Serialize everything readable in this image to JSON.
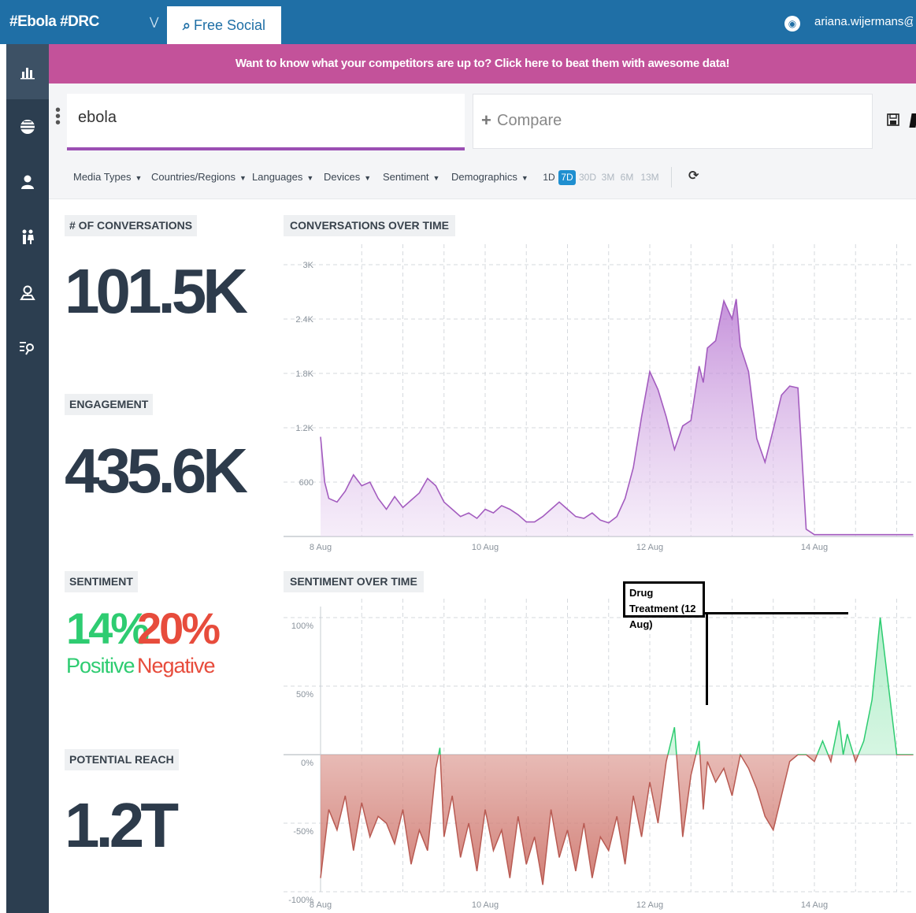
{
  "topbar": {
    "project": "#Ebola #DRC",
    "tab_label": "Free Social Search",
    "user": "ariana.wijermans@g..."
  },
  "sidebar": {
    "items": [
      {
        "icon": "bar-chart-icon",
        "active": true
      },
      {
        "icon": "globe-icon"
      },
      {
        "icon": "person-icon"
      },
      {
        "icon": "people-icon"
      },
      {
        "icon": "location-icon"
      },
      {
        "icon": "search-list-icon"
      }
    ]
  },
  "banner": {
    "text": "Want to know what your competitors are up to? Click here to beat them with awesome data!"
  },
  "search": {
    "query": "ebola",
    "compare_label": "Compare"
  },
  "filters": {
    "items": [
      "Media Types",
      "Countries/Regions",
      "Languages",
      "Devices",
      "Sentiment",
      "Demographics"
    ],
    "ranges": [
      "1D",
      "7D",
      "30D",
      "3M",
      "6M",
      "13M"
    ],
    "active_range": "7D"
  },
  "metrics": {
    "conversations_label": "# OF CONVERSATIONS",
    "conversations_value": "101.5K",
    "engagement_label": "ENGAGEMENT",
    "engagement_value": "435.6K",
    "sentiment_label": "SENTIMENT",
    "positive_pct": "14%",
    "positive_label": "Positive",
    "negative_pct": "20%",
    "negative_label": "Negative",
    "reach_label": "POTENTIAL REACH",
    "reach_value": "1.2T"
  },
  "colors": {
    "topbar": "#1f6fa6",
    "sidebar": "#2c3e50",
    "banner": "#c3529a",
    "conversations_line": "#a35cbf",
    "positive": "#2ecc71",
    "negative": "#e74c3c",
    "negative_line": "#b85a52"
  },
  "chart_data": [
    {
      "type": "area",
      "title": "CONVERSATIONS OVER TIME",
      "x_ticks": [
        "8 Aug",
        "10 Aug",
        "12 Aug",
        "14 Aug"
      ],
      "y_ticks": [
        "600",
        "1.2K",
        "1.8K",
        "2.4K",
        "3K"
      ],
      "ylim": [
        0,
        3000
      ],
      "grid": true,
      "series": [
        {
          "x_days": [
            0,
            0.05,
            0.1,
            0.2,
            0.3,
            0.4,
            0.5,
            0.6,
            0.7,
            0.8,
            0.9,
            1.0,
            1.1,
            1.2,
            1.3,
            1.4,
            1.5,
            1.6,
            1.7,
            1.8,
            1.9,
            2.0,
            2.1,
            2.2,
            2.3,
            2.4,
            2.5,
            2.6,
            2.7,
            2.8,
            2.9,
            3.0,
            3.1,
            3.2,
            3.3,
            3.4,
            3.5,
            3.6,
            3.7,
            3.8,
            3.9,
            4.0,
            4.1,
            4.2,
            4.3,
            4.4,
            4.5,
            4.6,
            4.65,
            4.7,
            4.8,
            4.9,
            5.0,
            5.05,
            5.1,
            5.2,
            5.3,
            5.4,
            5.5,
            5.6,
            5.7,
            5.8,
            5.9,
            6.0,
            6.1,
            6.2,
            6.3,
            6.35,
            6.4,
            6.5,
            7.0,
            7.2
          ],
          "values": [
            1100,
            600,
            420,
            380,
            500,
            680,
            560,
            600,
            420,
            300,
            440,
            320,
            400,
            480,
            640,
            560,
            380,
            300,
            220,
            260,
            200,
            300,
            260,
            340,
            300,
            240,
            160,
            160,
            220,
            300,
            380,
            300,
            220,
            200,
            260,
            180,
            150,
            220,
            420,
            760,
            1320,
            1820,
            1620,
            1320,
            960,
            1220,
            1280,
            1880,
            1700,
            2080,
            2160,
            2600,
            2400,
            2620,
            2100,
            1820,
            1080,
            820,
            1180,
            1560,
            1660,
            1640,
            80,
            20,
            20,
            20,
            20,
            20,
            20,
            20,
            20,
            20
          ],
          "color": "#a35cbf"
        }
      ]
    },
    {
      "type": "area",
      "title": "SENTIMENT OVER TIME",
      "x_ticks": [
        "8 Aug",
        "10 Aug",
        "12 Aug",
        "14 Aug"
      ],
      "y_ticks": [
        "100%",
        "50%",
        "0%",
        "-50%",
        "-100%"
      ],
      "ylim": [
        -100,
        100
      ],
      "grid": true,
      "annotation": {
        "text": "Drug Treatment (12 Aug)"
      },
      "series": [
        {
          "x_days": [
            0,
            0.1,
            0.2,
            0.3,
            0.4,
            0.5,
            0.6,
            0.7,
            0.8,
            0.9,
            1.0,
            1.1,
            1.2,
            1.3,
            1.4,
            1.45,
            1.5,
            1.6,
            1.7,
            1.8,
            1.9,
            2.0,
            2.1,
            2.2,
            2.3,
            2.4,
            2.5,
            2.6,
            2.7,
            2.8,
            2.9,
            3.0,
            3.1,
            3.2,
            3.3,
            3.4,
            3.5,
            3.6,
            3.7,
            3.8,
            3.9,
            4.0,
            4.1,
            4.2,
            4.3,
            4.4,
            4.5,
            4.6,
            4.65,
            4.7,
            4.8,
            4.9,
            5.0,
            5.1,
            5.2,
            5.3,
            5.4,
            5.5,
            5.6,
            5.7,
            5.8,
            5.9,
            6.0,
            6.1,
            6.2,
            6.3,
            6.35,
            6.4,
            6.5,
            6.6,
            6.7,
            6.8,
            7.0,
            7.2
          ],
          "values": [
            -90,
            -40,
            -55,
            -30,
            -70,
            -35,
            -60,
            -45,
            -50,
            -65,
            -40,
            -80,
            -55,
            -70,
            -10,
            5,
            -60,
            -30,
            -75,
            -50,
            -85,
            -40,
            -70,
            -55,
            -90,
            -45,
            -80,
            -60,
            -95,
            -40,
            -75,
            -55,
            -85,
            -50,
            -90,
            -60,
            -70,
            -45,
            -80,
            -30,
            -60,
            -20,
            -50,
            -5,
            20,
            -60,
            -15,
            10,
            -40,
            -5,
            -20,
            -10,
            -30,
            0,
            -10,
            -25,
            -45,
            -55,
            -30,
            -5,
            0,
            0,
            -5,
            10,
            -5,
            25,
            0,
            15,
            -5,
            10,
            40,
            100,
            0,
            0
          ],
          "color": "#b85a52"
        }
      ]
    }
  ]
}
